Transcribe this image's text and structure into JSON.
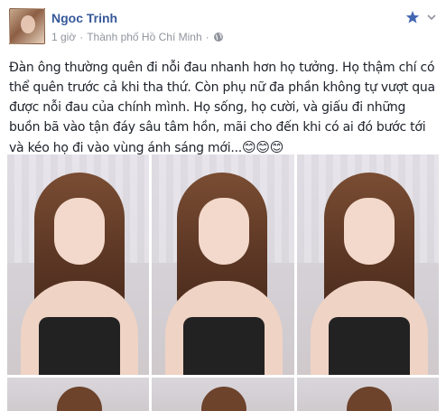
{
  "post": {
    "author": "Ngoc Trinh",
    "time": "1 giờ",
    "separator": "·",
    "location": "Thành phố Hồ Chí Minh",
    "separator2": "·",
    "text": "Đàn ông thường quên đi nỗi đau nhanh hơn họ tưởng. Họ thậm chí có thể quên trước cả khi tha thứ. Còn phụ nữ đa phần không tự vượt qua được nỗi đau của chính mình. Họ sống, họ cười, và giấu đi những buồn bã vào tận đáy sâu tâm hồn, mãi cho đến khi có ai đó bước tới và kéo họ đi vào vùng ánh sáng mới...",
    "emojis": "😊😊😊"
  },
  "icons": {
    "avatar": "avatar",
    "globe": "globe-icon",
    "star": "star-icon",
    "chevron": "chevron-down-icon"
  },
  "colors": {
    "author": "#365899",
    "meta": "#90949c",
    "star": "#4267b2"
  }
}
